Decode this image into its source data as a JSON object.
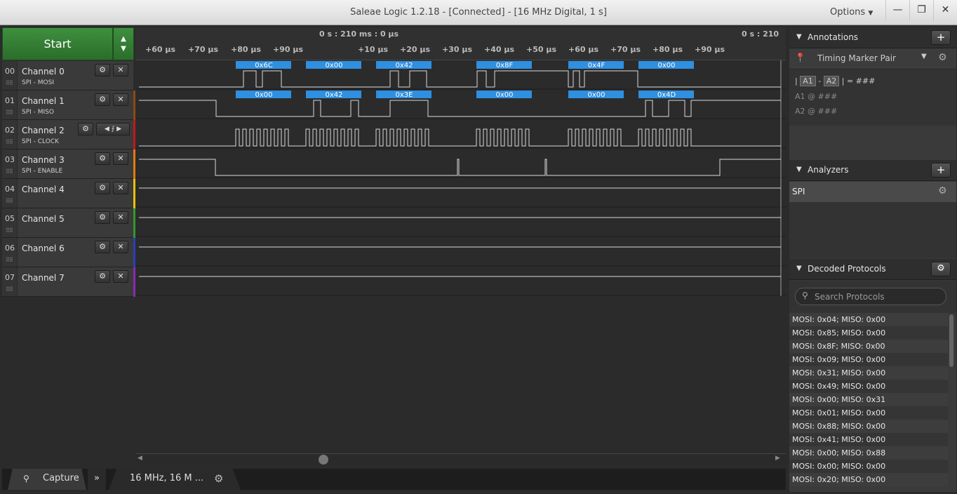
{
  "window": {
    "title": "Saleae Logic 1.2.18 - [Connected] - [16 MHz Digital, 1 s]",
    "options_label": "Options",
    "minimize": "—",
    "restore": "❐",
    "close": "✕"
  },
  "controls": {
    "start_label": "Start"
  },
  "channels": [
    {
      "num": "00",
      "name": "Channel 0",
      "sub": "SPI - MOSI",
      "color": "#2b2b2b"
    },
    {
      "num": "01",
      "name": "Channel 1",
      "sub": "SPI - MISO",
      "color": "#8a4a14"
    },
    {
      "num": "02",
      "name": "Channel 2",
      "sub": "SPI - CLOCK",
      "color": "#c0181a"
    },
    {
      "num": "03",
      "name": "Channel 3",
      "sub": "SPI - ENABLE",
      "color": "#e07a10"
    },
    {
      "num": "04",
      "name": "Channel 4",
      "sub": "",
      "color": "#e6c20e"
    },
    {
      "num": "05",
      "name": "Channel 5",
      "sub": "",
      "color": "#2e9a2e"
    },
    {
      "num": "06",
      "name": "Channel 6",
      "sub": "",
      "color": "#2a3fb8"
    },
    {
      "num": "07",
      "name": "Channel 7",
      "sub": "",
      "color": "#8a2ab0"
    }
  ],
  "ruler": {
    "center_time": "0 s : 210 ms : 0 μs",
    "right_time": "0 s : 210",
    "ticks": [
      "+60 μs",
      "+70 μs",
      "+80 μs",
      "+90 μs",
      "+10 μs",
      "+20 μs",
      "+30 μs",
      "+40 μs",
      "+50 μs",
      "+60 μs",
      "+70 μs",
      "+80 μs",
      "+90 μs"
    ]
  },
  "decode_labels": {
    "mosi": [
      "0x6C",
      "0x00",
      "0x42",
      "0x8F",
      "0x4F",
      "0x00"
    ],
    "miso": [
      "0x00",
      "0x42",
      "0x3E",
      "0x00",
      "0x00",
      "0x4D"
    ]
  },
  "bottom": {
    "capture_label": "Capture",
    "session_label": "16 MHz, 16 M ..."
  },
  "annotations": {
    "title": "Annotations",
    "marker_pair": "Timing Marker Pair",
    "a1": "A1",
    "a2": "A2",
    "dash": "-",
    "eq_value": "= ###",
    "a1_label": "A1",
    "a2_label": "A2",
    "at": "@",
    "a1_value": "###",
    "a2_value": "###"
  },
  "analyzers": {
    "title": "Analyzers",
    "items": [
      "SPI"
    ]
  },
  "decoded": {
    "title": "Decoded Protocols",
    "search_placeholder": "Search Protocols",
    "rows": [
      "MOSI: 0x04;  MISO: 0x00",
      "MOSI: 0x85;  MISO: 0x00",
      "MOSI: 0x8F;  MISO: 0x00",
      "MOSI: 0x09;  MISO: 0x00",
      "MOSI: 0x31;  MISO: 0x00",
      "MOSI: 0x49;  MISO: 0x00",
      "MOSI: 0x00;  MISO: 0x31",
      "MOSI: 0x01;  MISO: 0x00",
      "MOSI: 0x88;  MISO: 0x00",
      "MOSI: 0x41;  MISO: 0x00",
      "MOSI: 0x00;  MISO: 0x88",
      "MOSI: 0x00;  MISO: 0x00",
      "MOSI: 0x20;  MISO: 0x00"
    ]
  }
}
